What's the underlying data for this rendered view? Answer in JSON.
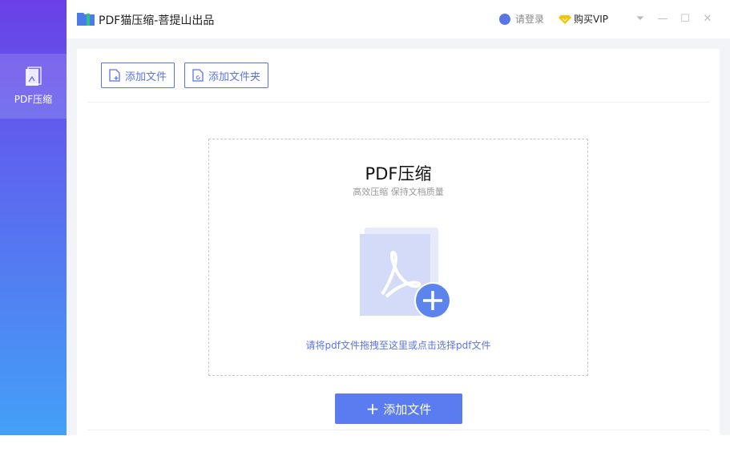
{
  "app": {
    "title": "PDF猫压缩-菩提山出品",
    "login": "请登录",
    "vip": "购买VIP"
  },
  "sidebar": {
    "items": [
      {
        "label": "PDF压缩"
      }
    ]
  },
  "toolbar": {
    "add_file": "添加文件",
    "add_folder": "添加文件夹"
  },
  "dropzone": {
    "title": "PDF压缩",
    "subtitle": "高效压缩 保持文档质量",
    "hint": "请将pdf文件拖拽至这里或点击选择pdf文件"
  },
  "primary_button": {
    "label": "添加文件",
    "icon": "+"
  },
  "colors": {
    "accent": "#5b74e8",
    "sidebar_top": "#6a40e6",
    "sidebar_bottom": "#43a0f7"
  }
}
